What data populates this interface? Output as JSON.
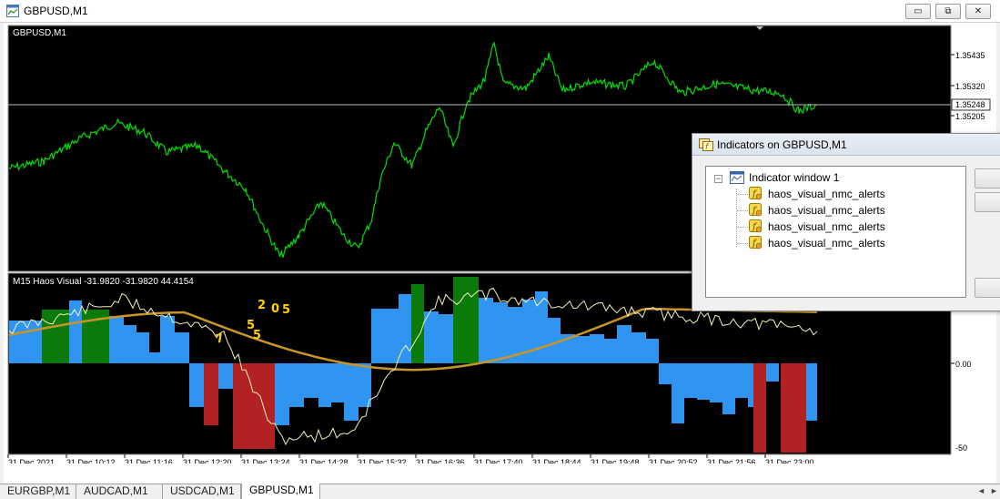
{
  "window": {
    "title": "GBPUSD,M1",
    "minimize_label": "▭",
    "restore_label": "⧉",
    "close_label": "✕"
  },
  "main_chart": {
    "label": "GBPUSD,M1",
    "price_labels": [
      "1.35435",
      "1.35320",
      "1.35205"
    ],
    "current_price": "1.35248",
    "line_color": "#00e000"
  },
  "indicator": {
    "label": "M15 Haos Visual -31.9820 -31.9820 44.4154",
    "scale_labels": [
      "0.00",
      "-50"
    ],
    "annotations": [
      "7",
      "5",
      "5",
      "2",
      "0",
      "5"
    ],
    "colors": {
      "blue": "#2f95f0",
      "green": "#0a7a0a",
      "red": "#b22222",
      "gold": "#c89628",
      "line": "#f5f0b8"
    }
  },
  "time_axis": [
    "31 Dec 2021",
    "31 Dec 10:12",
    "31 Dec 11:16",
    "31 Dec 12:20",
    "31 Dec 13:24",
    "31 Dec 14:28",
    "31 Dec 15:32",
    "31 Dec 16:36",
    "31 Dec 17:40",
    "31 Dec 18:44",
    "31 Dec 19:48",
    "31 Dec 20:52",
    "31 Dec 21:56",
    "31 Dec 23:00"
  ],
  "dialog": {
    "title": "Indicators on GBPUSD,M1",
    "tree_root": "Indicator window 1",
    "expander": "−",
    "items": [
      "haos_visual_nmc_alerts",
      "haos_visual_nmc_alerts",
      "haos_visual_nmc_alerts",
      "haos_visual_nmc_alerts"
    ]
  },
  "tabs": [
    "EURGBP,M1",
    "AUDCAD,M1",
    "USDCAD,M1",
    "GBPUSD,M1"
  ],
  "active_tab": "GBPUSD,M1",
  "scroll_left_label": "◄",
  "scroll_right_label": "►"
}
